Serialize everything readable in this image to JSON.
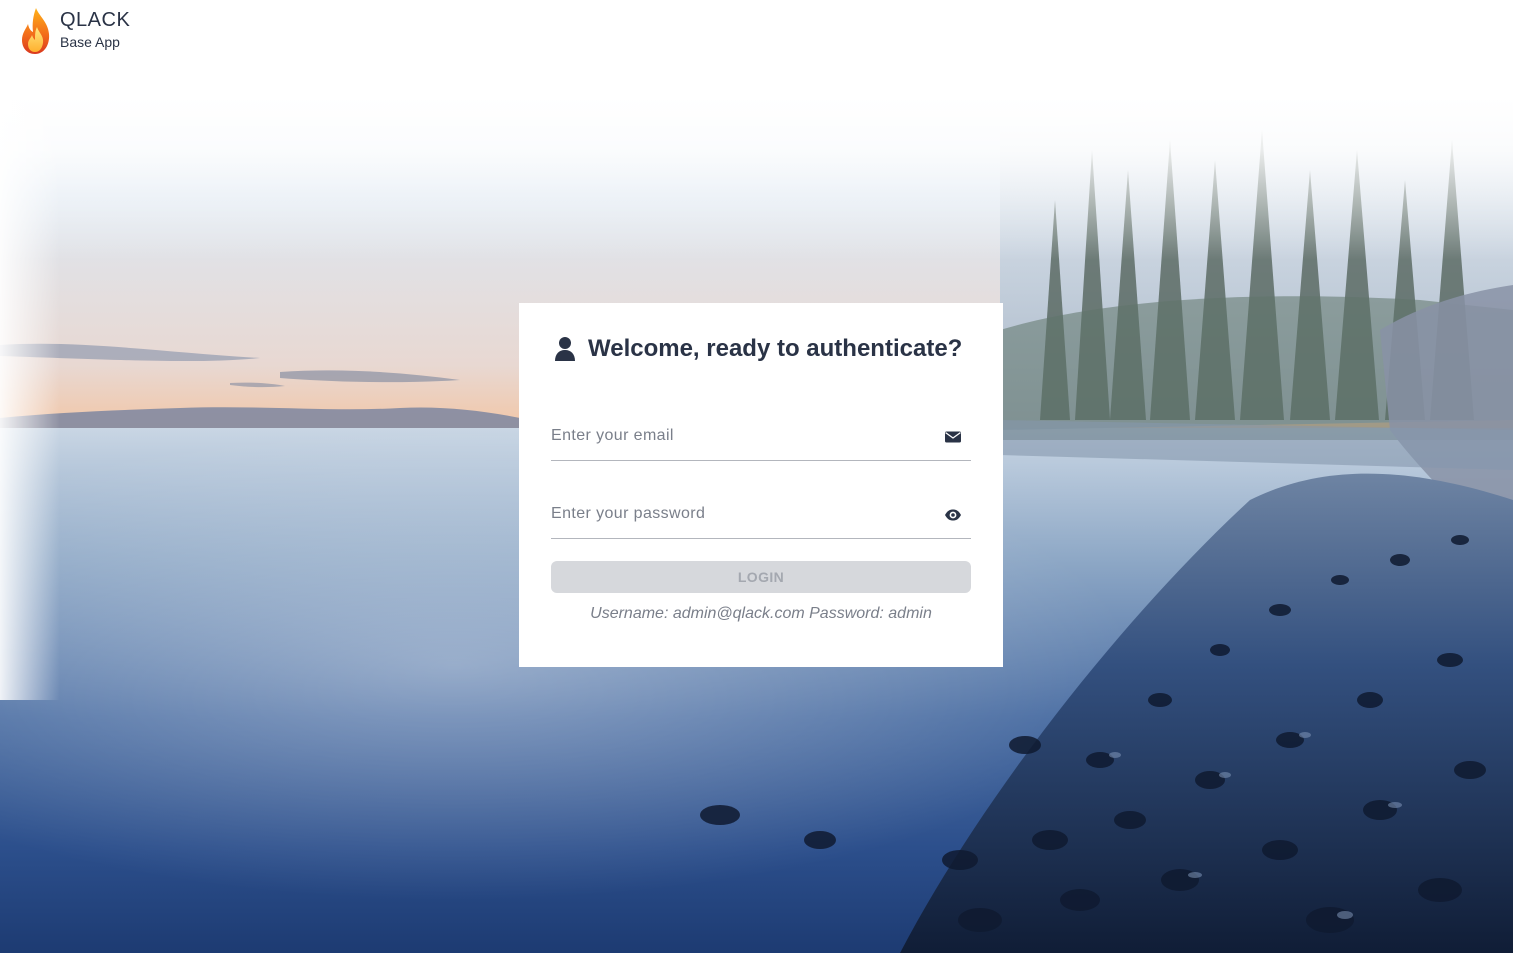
{
  "brand": {
    "title": "QLACK",
    "subtitle": "Base App",
    "logo_icon": "flame-icon"
  },
  "login": {
    "title": "Welcome, ready to authenticate?",
    "title_icon": "user-icon",
    "email": {
      "placeholder": "Enter your email",
      "value": "",
      "icon": "envelope-icon"
    },
    "password": {
      "placeholder": "Enter your password",
      "value": "",
      "icon": "eye-icon"
    },
    "login_label": "LOGIN",
    "hint": "Username: admin@qlack.com Password: admin"
  },
  "colors": {
    "text_primary": "#2a3346",
    "text_muted": "#7a7f8a",
    "button_disabled_bg": "#d6d8dc",
    "button_disabled_text": "#a4a8b0"
  }
}
